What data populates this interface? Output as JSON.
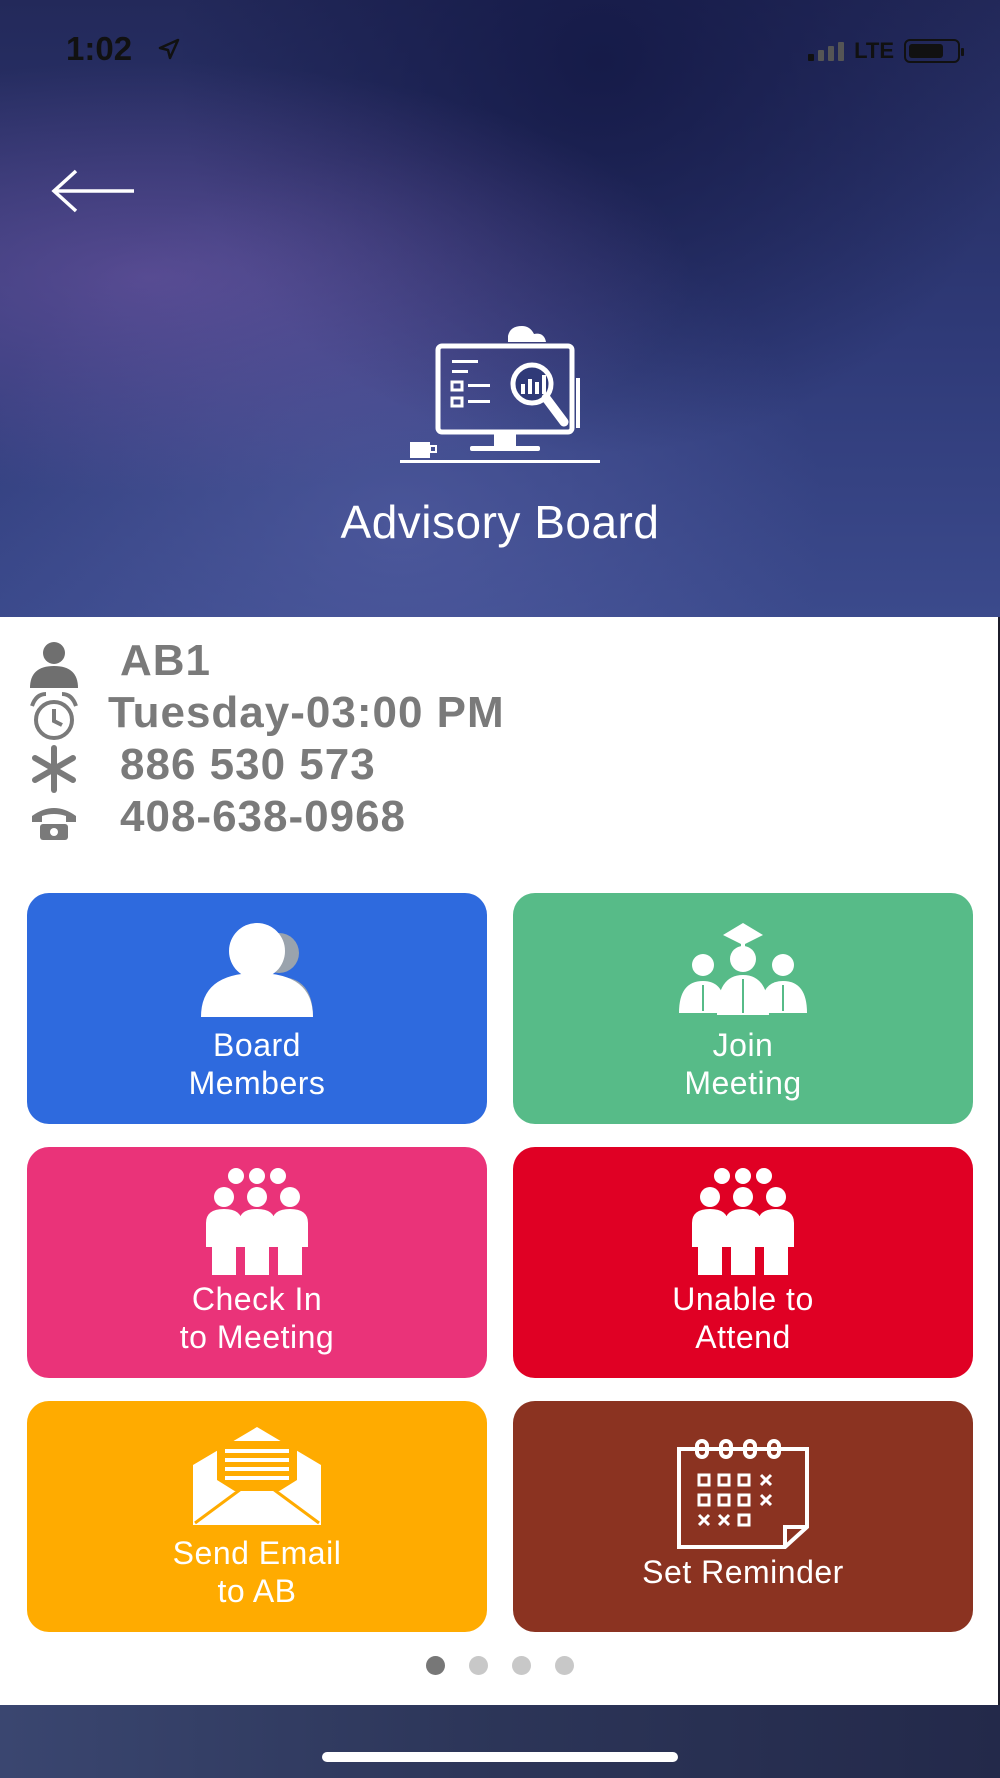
{
  "status_bar": {
    "time": "1:02",
    "network": "LTE",
    "location_icon": "location-arrow-icon"
  },
  "header": {
    "back_icon": "back-arrow-icon",
    "title": "Advisory Board",
    "hero_icon": "computer-analytics-icon"
  },
  "info": {
    "group": {
      "icon": "person-icon",
      "value": "AB1"
    },
    "schedule": {
      "icon": "alarm-clock-icon",
      "value": "Tuesday-03:00 PM"
    },
    "meeting_id": {
      "icon": "asterisk-icon",
      "value": "886 530 573"
    },
    "phone": {
      "icon": "telephone-icon",
      "value": "408-638-0968"
    }
  },
  "tiles": [
    {
      "line1": "Board",
      "line2": "Members",
      "color": "#2e6ade",
      "icon": "board-members-icon"
    },
    {
      "line1": "Join",
      "line2": "Meeting",
      "color": "#57bb88",
      "icon": "join-meeting-icon"
    },
    {
      "line1": "Check In",
      "line2": "to Meeting",
      "color": "#ea3379",
      "icon": "check-in-group-icon"
    },
    {
      "line1": "Unable to",
      "line2": "Attend",
      "color": "#e00024",
      "icon": "unable-group-icon"
    },
    {
      "line1": "Send Email",
      "line2": "to AB",
      "color": "#ffab00",
      "icon": "email-envelope-icon"
    },
    {
      "line1": "Set Reminder",
      "line2": "",
      "color": "#8b3321",
      "icon": "calendar-reminder-icon"
    }
  ],
  "pagination": {
    "pages": 4,
    "active": 1
  },
  "colors": {
    "header_dark": "#23295a",
    "info_text": "#7a7a7a",
    "dot_active": "#777777",
    "dot_inactive": "#c8c8c8"
  }
}
